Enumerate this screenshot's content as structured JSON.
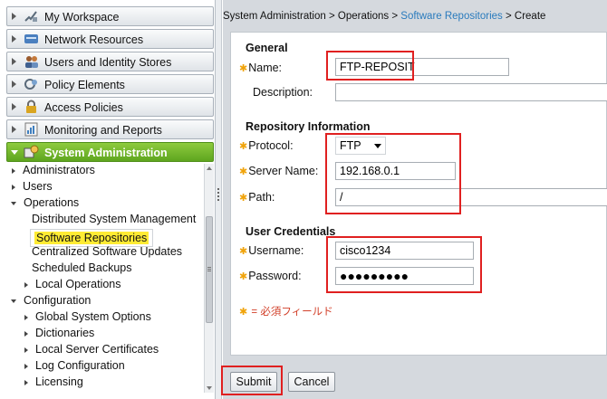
{
  "nav": {
    "drawers": [
      {
        "label": "My Workspace",
        "icon": "workspace-icon"
      },
      {
        "label": "Network Resources",
        "icon": "network-icon"
      },
      {
        "label": "Users and Identity Stores",
        "icon": "users-icon"
      },
      {
        "label": "Policy Elements",
        "icon": "policy-icon"
      },
      {
        "label": "Access Policies",
        "icon": "lock-icon"
      },
      {
        "label": "Monitoring and Reports",
        "icon": "reports-icon"
      },
      {
        "label": "System Administration",
        "icon": "system-admin-icon"
      }
    ],
    "tree": [
      {
        "label": "Administrators",
        "state": "collapsed"
      },
      {
        "label": "Users",
        "state": "collapsed"
      },
      {
        "label": "Operations",
        "state": "expanded"
      },
      {
        "label": "Distributed System Management",
        "state": "leaf"
      },
      {
        "label": "Software Repositories",
        "state": "leaf",
        "selected": true
      },
      {
        "label": "Centralized Software Updates",
        "state": "leaf"
      },
      {
        "label": "Scheduled Backups",
        "state": "leaf"
      },
      {
        "label": "Local Operations",
        "state": "collapsed"
      },
      {
        "label": "Configuration",
        "state": "expanded"
      },
      {
        "label": "Global System Options",
        "state": "collapsed"
      },
      {
        "label": "Dictionaries",
        "state": "collapsed"
      },
      {
        "label": "Local Server Certificates",
        "state": "collapsed"
      },
      {
        "label": "Log Configuration",
        "state": "collapsed"
      },
      {
        "label": "Licensing",
        "state": "collapsed"
      }
    ]
  },
  "breadcrumb": {
    "part1": "System Administration",
    "sep": ">",
    "part2": "Operations",
    "part3": "Software Repositories",
    "part4": "Create"
  },
  "form": {
    "general_title": "General",
    "name_label": "Name:",
    "name_value": "FTP-REPOSIT",
    "description_label": "Description:",
    "description_value": "",
    "repo_title": "Repository Information",
    "protocol_label": "Protocol:",
    "protocol_value": "FTP",
    "server_label": "Server Name:",
    "server_value": "192.168.0.1",
    "path_label": "Path:",
    "path_value": "/",
    "cred_title": "User Credentials",
    "username_label": "Username:",
    "username_value": "cisco1234",
    "password_label": "Password:",
    "password_value": "●●●●●●●●●",
    "required_note": "= 必須フィールド",
    "required_mark": "✱"
  },
  "buttons": {
    "submit": "Submit",
    "cancel": "Cancel"
  },
  "colors": {
    "active_drawer": "#6db02a",
    "highlight": "#ffeb34",
    "annotation": "#e02020",
    "required": "#f0a30a",
    "breadcrumb_link": "#2a7bbd"
  }
}
